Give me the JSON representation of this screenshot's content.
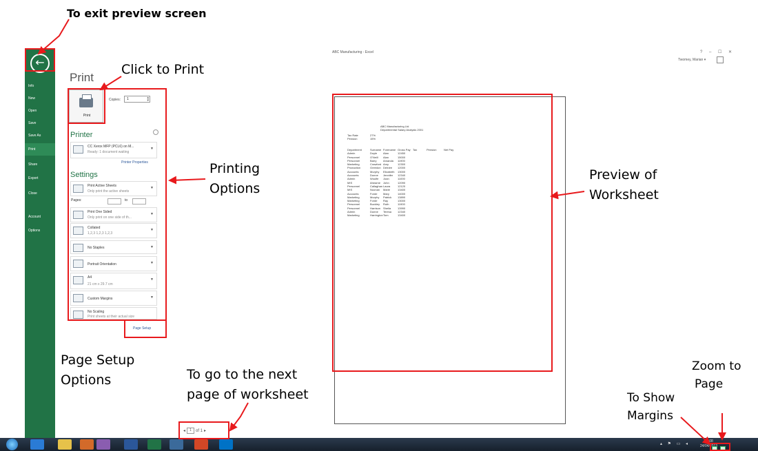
{
  "annotations": {
    "exit_preview": "To exit preview screen",
    "click_to_print": "Click to Print",
    "printing_options": [
      "Printing",
      "Options"
    ],
    "page_setup_options": [
      "Page Setup",
      "Options"
    ],
    "next_page": [
      "To go to the next",
      "page of worksheet"
    ],
    "preview_of_worksheet": [
      "Preview of",
      "Worksheet"
    ],
    "zoom_to_page": [
      "Zoom to",
      "Page"
    ],
    "show_margins": [
      "To Show",
      "Margins"
    ]
  },
  "window": {
    "title": "ABC Manufacturing - Excel",
    "controls": "? – ☐ ✕",
    "user": "Twomey, Marian ▾"
  },
  "sidebar": {
    "back_glyph": "←",
    "items": [
      "Info",
      "New",
      "Open",
      "Save",
      "Save As",
      "Print",
      "Share",
      "Export",
      "Close",
      "Account",
      "Options"
    ],
    "active": "Print"
  },
  "print_panel": {
    "title": "Print",
    "print_button": "Print",
    "copies_label": "Copies:",
    "copies_value": "1",
    "printer_heading": "Printer",
    "printer_name": "CC Xerox MFP (PCL6) on M...",
    "printer_status": "Ready: 1 document waiting",
    "printer_properties": "Printer Properties",
    "settings_heading": "Settings",
    "pages_label": "Pages:",
    "to_label": "to",
    "settings": [
      {
        "line1": "Print Active Sheets",
        "line2": "Only print the active sheets"
      },
      {
        "line1": "Print One Sided",
        "line2": "Only print on one side of th..."
      },
      {
        "line1": "Collated",
        "line2": "1,2,3   1,2,3   1,2,3"
      },
      {
        "line1": "No Staples",
        "line2": ""
      },
      {
        "line1": "Portrait Orientation",
        "line2": ""
      },
      {
        "line1": "A4",
        "line2": "21 cm x 29.7 cm"
      },
      {
        "line1": "Custom Margins",
        "line2": ""
      },
      {
        "line1": "No Scaling",
        "line2": "Print sheets at their actual size"
      }
    ],
    "page_setup_link": "Page Setup"
  },
  "worksheet": {
    "title": "ABC Manufacturing Ltd",
    "subtitle": "Departmental Salary Analysis 2001",
    "meta": [
      {
        "label": "Tax Rate",
        "value": "27%"
      },
      {
        "label": "Pension",
        "value": "15%"
      }
    ],
    "headers": [
      "Department",
      "Surname",
      "Forename",
      "Gross Pay",
      "Tax",
      "Pension",
      "Net Pay"
    ],
    "rows": [
      [
        "Admin",
        "Doyle",
        "Alan",
        "12450"
      ],
      [
        "Personnel",
        "O'Neill",
        "Alan",
        "15000"
      ],
      [
        "Personnel",
        "Barry",
        "Amanda",
        "11900"
      ],
      [
        "Marketing",
        "Crawford",
        "Amy",
        "12300"
      ],
      [
        "Production",
        "Greedon",
        "Deirdre",
        "12000"
      ],
      [
        "Accounts",
        "Murphy",
        "Elizabeth",
        "13000"
      ],
      [
        "Accounts",
        "Dunne",
        "Jennifer",
        "12340"
      ],
      [
        "Admin",
        "Woulfe",
        "Joan",
        "11000"
      ],
      [
        "MIS",
        "Ahearne",
        "John",
        "12090"
      ],
      [
        "Personnel",
        "Callaghan",
        "Laura",
        "12120"
      ],
      [
        "MIS",
        "Noonan",
        "Marie",
        "13400"
      ],
      [
        "Accounts",
        "Forde",
        "Mary",
        "14000"
      ],
      [
        "Marketing",
        "Murphy",
        "Patrick",
        "13890"
      ],
      [
        "Marketing",
        "Forde",
        "Ray",
        "13000"
      ],
      [
        "Personnel",
        "Buckley",
        "Ruth",
        "11900"
      ],
      [
        "Personnel",
        "Harrison",
        "Sheila",
        "13990"
      ],
      [
        "Admin",
        "Dunne",
        "Teresa",
        "12340"
      ],
      [
        "Marketing",
        "Harrington",
        "Tom",
        "13400"
      ]
    ]
  },
  "page_nav": {
    "prev": "◂",
    "current": "1",
    "of_text": "of 1",
    "next": "▸"
  },
  "taskbar": {
    "tray": "▴ ⚑ ▭ ◂",
    "time": "12:08",
    "date": "24/04/2013"
  },
  "colors": {
    "excel_green": "#217346",
    "annotation_red": "#e8191c"
  }
}
